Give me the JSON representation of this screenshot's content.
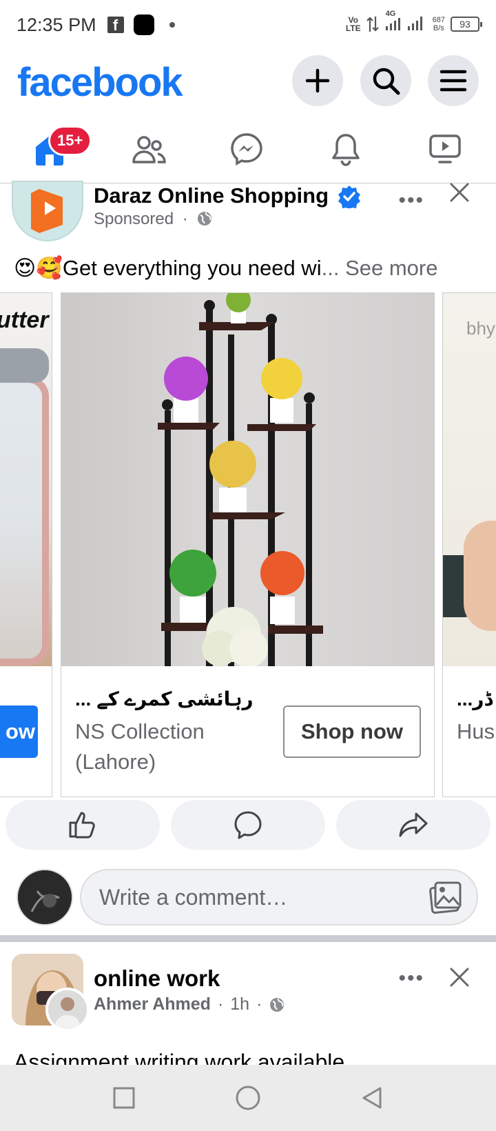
{
  "status_bar": {
    "time": "12:35 PM",
    "fb_glyph": "f",
    "volte_top": "Vo",
    "volte_bottom": "LTE",
    "net_gen": "4G",
    "speed_value": "687",
    "speed_unit": "B/s",
    "battery": "93"
  },
  "header": {
    "logo": "facebook",
    "create_icon": "plus-icon",
    "search_icon": "search-icon",
    "menu_icon": "hamburger-icon"
  },
  "nav": {
    "home_badge": "15+",
    "tabs": [
      "home-icon",
      "friends-icon",
      "messenger-icon",
      "bell-icon",
      "video-icon"
    ]
  },
  "post1": {
    "page_name": "Daraz Online Shopping",
    "sponsored": "Sponsored",
    "separator": "·",
    "emojis": "😍🥰",
    "text": "Get everything you need wi",
    "ellipsis": "...",
    "see_more": "See more",
    "carousel": {
      "left_card_fragment": "utter",
      "left_button_fragment": "ow",
      "right_card_fragment": "bhy",
      "right_title_fragment": "...ڈر",
      "right_sub_fragment": "Hus",
      "main_card": {
        "title": "رہائشی کمرے کے ...",
        "subtitle": "NS Collection (Lahore)",
        "cta": "Shop now"
      }
    },
    "comment_placeholder": "Write a comment…"
  },
  "post2": {
    "group_name": "online work",
    "author": "Ahmer Ahmed",
    "time": "1h",
    "separator": "·",
    "text": "Assignment writing work available"
  },
  "colors": {
    "brand": "#1877f2",
    "badge": "#e41e3f",
    "secondary_text": "#65676b"
  }
}
